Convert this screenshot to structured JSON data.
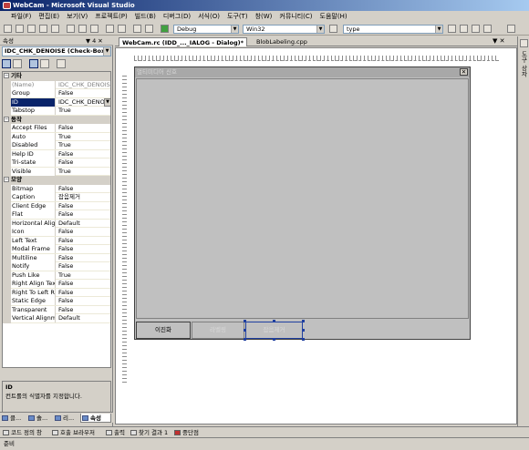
{
  "window": {
    "title": "WebCam - Microsoft Visual Studio"
  },
  "menu": [
    "파일(F)",
    "편집(E)",
    "보기(V)",
    "프로젝트(P)",
    "빌드(B)",
    "디버그(D)",
    "서식(O)",
    "도구(T)",
    "창(W)",
    "커뮤니티(C)",
    "도움말(H)"
  ],
  "toolbar": {
    "config": "Debug",
    "platform": "Win32",
    "find": "type"
  },
  "properties": {
    "title": "속성",
    "pin": "▼ 4 ✕",
    "object": "IDC_CHK_DENOISE (Check-Box Control)",
    "categories": [
      {
        "name": "기타",
        "props": [
          {
            "name": "(Name)",
            "value": "IDC_CHK_DENOISE",
            "grey": true
          },
          {
            "name": "Group",
            "value": "False"
          },
          {
            "name": "ID",
            "value": "IDC_CHK_DENOISE",
            "selected": true
          },
          {
            "name": "Tabstop",
            "value": "True"
          }
        ]
      },
      {
        "name": "동작",
        "props": [
          {
            "name": "Accept Files",
            "value": "False"
          },
          {
            "name": "Auto",
            "value": "True"
          },
          {
            "name": "Disabled",
            "value": "True"
          },
          {
            "name": "Help ID",
            "value": "False"
          },
          {
            "name": "Tri-state",
            "value": "False"
          },
          {
            "name": "Visible",
            "value": "True"
          }
        ]
      },
      {
        "name": "모양",
        "props": [
          {
            "name": "Bitmap",
            "value": "False"
          },
          {
            "name": "Caption",
            "value": "잡음제거"
          },
          {
            "name": "Client Edge",
            "value": "False"
          },
          {
            "name": "Flat",
            "value": "False"
          },
          {
            "name": "Horizontal Alignment",
            "value": "Default"
          },
          {
            "name": "Icon",
            "value": "False"
          },
          {
            "name": "Left Text",
            "value": "False"
          },
          {
            "name": "Modal Frame",
            "value": "False"
          },
          {
            "name": "Multiline",
            "value": "False"
          },
          {
            "name": "Notify",
            "value": "False"
          },
          {
            "name": "Push Like",
            "value": "True"
          },
          {
            "name": "Right Align Text",
            "value": "False"
          },
          {
            "name": "Right To Left Reading",
            "value": "False"
          },
          {
            "name": "Static Edge",
            "value": "False"
          },
          {
            "name": "Transparent",
            "value": "False"
          },
          {
            "name": "Vertical Alignment",
            "value": "Default"
          }
        ]
      }
    ],
    "description_title": "ID",
    "description_text": "컨트롤의 식별자를 지정합니다.",
    "bottom_tabs": [
      "클...",
      "솔...",
      "리...",
      "속성"
    ]
  },
  "documents": {
    "tabs": [
      "WebCam.rc (IDD_..._IALOG - Dialog)*",
      "BlobLabeling.cpp"
    ],
    "controls": "▼ ✕"
  },
  "dialog": {
    "title": "멀티미디어 신호",
    "close": "✕",
    "buttons": [
      "이진화",
      "라벨링",
      "잡음제거"
    ]
  },
  "toolbox": {
    "label": "도구 상자"
  },
  "output_tabs": [
    "코드 정의 창",
    "호출 브라우저",
    "출력",
    "찾기 결과 1",
    "중단점"
  ],
  "status": {
    "text": "준비"
  },
  "colors": {
    "titlebar": "#0a246a",
    "selection": "#0a246a",
    "chrome": "#d4d0c8"
  }
}
